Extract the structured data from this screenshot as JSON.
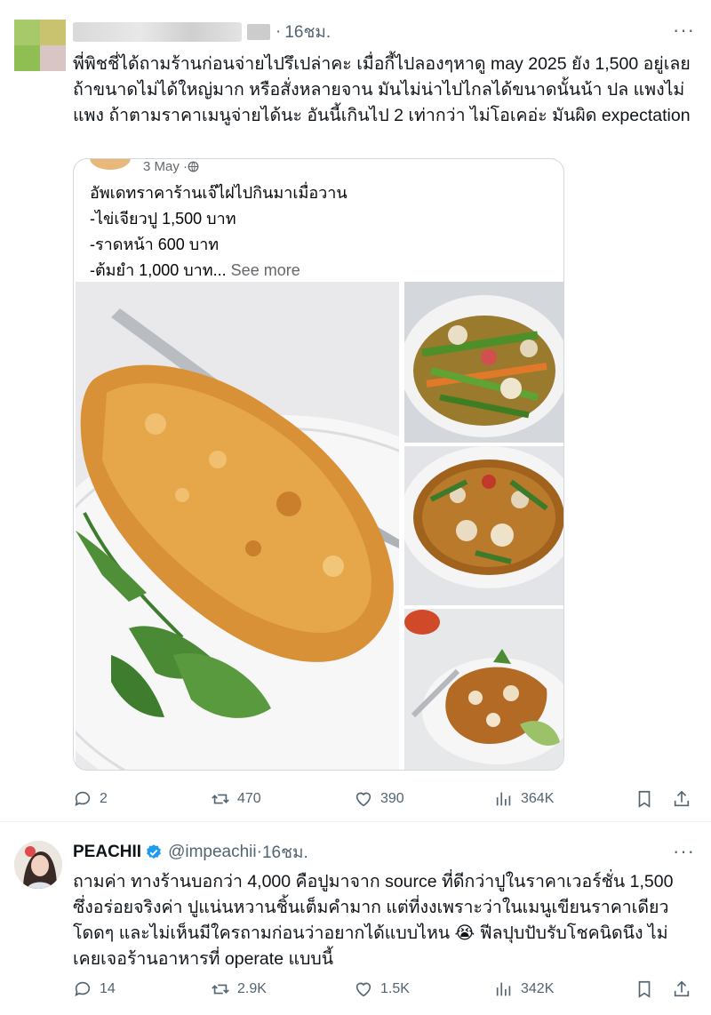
{
  "post1": {
    "time": "16ชม.",
    "text": "พี่พิชชี่ได้ถามร้านก่อนจ่ายไปรึเปล่าคะ เมื่อกี้ไปลองๆหาดู may 2025 ยัง 1,500 อยู่เลย ถ้าขนาดไม่ได้ใหญ่มาก หรือสั่งหลายจาน มันไม่น่าไปไกลได้ขนาดนั้นน้า ปล แพงไม่แพง ถ้าตามราคาเมนูจ่ายได้นะ อันนี้เกินไป 2 เท่ากว่า ไม่โอเคอ่ะ มันผิด expectation",
    "quote": {
      "date": "3 May · ",
      "lines": [
        "อัพเดทราคาร้านเจ๊ไฝไปกินมาเมื่อวาน",
        "-ไข่เจียวปู 1,500 บาท",
        "-ราดหน้า 600 บาท",
        "-ต้มยำ 1,000 บาท..."
      ],
      "see_more": "See more"
    },
    "actions": {
      "replies": "2",
      "reposts": "470",
      "likes": "390",
      "views": "364K"
    }
  },
  "post2": {
    "name": "PEACHII",
    "handle": "@impeachii",
    "dot": " · ",
    "time": "16ชม.",
    "text_a": "ถามค่า ทางร้านบอกว่า 4,000 คือปูมาจาก source ที่ดีกว่าปูในราคาเวอร์ชั่น 1,500 ซึ่งอร่อยจริงค่า ปูแน่นหวานชิ้นเต็มคำมาก แต่ที่งงเพราะว่าในเมนูเขียนราคาเดียวโดดๆ และไม่เห็นมีใครถามก่อนว่าอยากได้แบบไหน ",
    "emoji": "😭",
    "text_b": " ฟีลปุบปับรับโชคนิดนึง ไม่เคยเจอร้านอาหารที่ operate แบบนี้",
    "actions": {
      "replies": "14",
      "reposts": "2.9K",
      "likes": "1.5K",
      "views": "342K"
    }
  },
  "more_glyph": "···",
  "colors": {
    "muted": "#536471",
    "verified": "#1d9bf0",
    "border": "#cfd9de"
  }
}
